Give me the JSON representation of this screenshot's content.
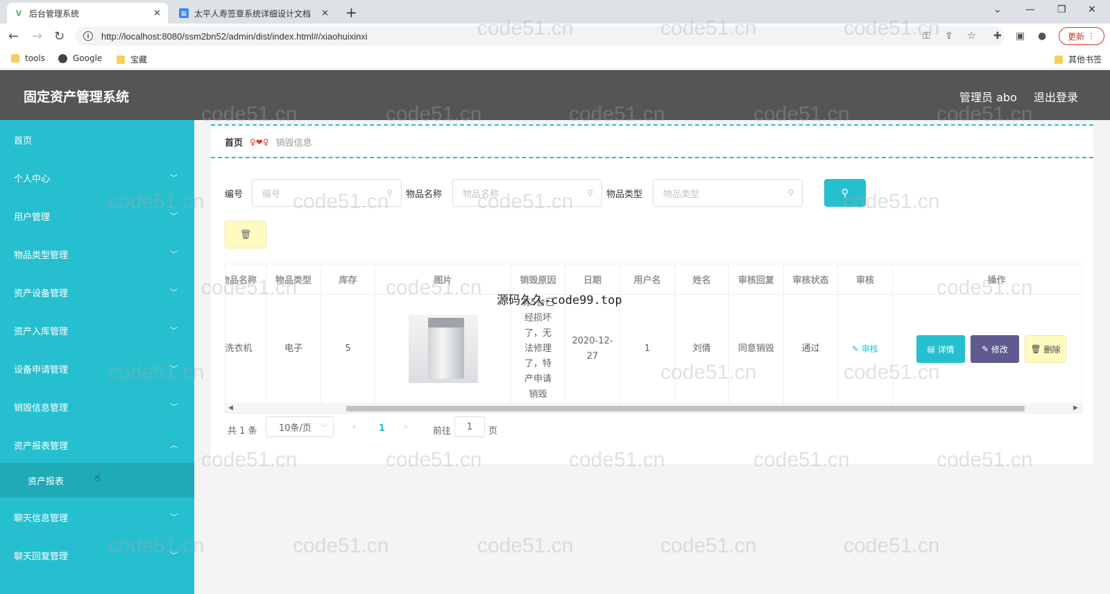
{
  "browser": {
    "tabs": [
      {
        "title": "后台管理系统",
        "active": true
      },
      {
        "title": "太平人寿签章系统详细设计文档",
        "active": false
      }
    ],
    "url": "http://localhost:8080/ssm2bn52/admin/dist/index.html#/xiaohuixinxi",
    "update_label": "更新",
    "bookmarks": [
      "tools",
      "Google",
      "宝藏"
    ],
    "other_bookmarks": "其他书签"
  },
  "header": {
    "title": "固定资产管理系统",
    "user": "管理员 abo",
    "logout": "退出登录"
  },
  "sidebar": {
    "items": [
      {
        "label": "首页",
        "expandable": false
      },
      {
        "label": "个人中心",
        "expandable": true
      },
      {
        "label": "用户管理",
        "expandable": true
      },
      {
        "label": "物品类型管理",
        "expandable": true
      },
      {
        "label": "资产设备管理",
        "expandable": true
      },
      {
        "label": "资产入库管理",
        "expandable": true
      },
      {
        "label": "设备申请管理",
        "expandable": true
      },
      {
        "label": "销毁信息管理",
        "expandable": true
      },
      {
        "label": "资产报表管理",
        "expandable": true,
        "expanded": true
      },
      {
        "label": "聊天信息管理",
        "expandable": true
      },
      {
        "label": "聊天回复管理",
        "expandable": true
      }
    ],
    "submenu": {
      "label": "资产报表"
    }
  },
  "breadcrumb": {
    "home": "首页",
    "separator": "♀❤♀",
    "current": "销毁信息"
  },
  "search": {
    "fields": [
      {
        "label": "编号",
        "placeholder": "编号"
      },
      {
        "label": "物品名称",
        "placeholder": "物品名称"
      },
      {
        "label": "物品类型",
        "placeholder": "物品类型"
      }
    ]
  },
  "table": {
    "headers": [
      "物品名称",
      "物品类型",
      "库存",
      "图片",
      "销毁原因",
      "日期",
      "用户名",
      "姓名",
      "审核回复",
      "审核状态",
      "审核",
      "操作"
    ],
    "rows": [
      {
        "name": "洗衣机",
        "type": "电子",
        "stock": "5",
        "reason": "有5台已经损坏了，无法修理了，特产申请销毁",
        "date": "2020-12-27",
        "username": "1",
        "realname": "刘倩",
        "reply": "同意销毁",
        "status": "通过",
        "audit": "审核"
      }
    ],
    "actions": {
      "detail": "详情",
      "edit": "修改",
      "delete": "删除"
    }
  },
  "pagination": {
    "total": "共 1 条",
    "page_size": "10条/页",
    "current_page": "1",
    "goto_prefix": "前往",
    "goto_value": "1",
    "goto_suffix": "页"
  },
  "watermarks": {
    "site": "code51.cn",
    "overlay": "源码久久-code99.top"
  },
  "colors": {
    "accent": "#26bfcf",
    "header": "#555555",
    "edit_button": "#5f5b91",
    "delete_button": "#fffbc0"
  }
}
